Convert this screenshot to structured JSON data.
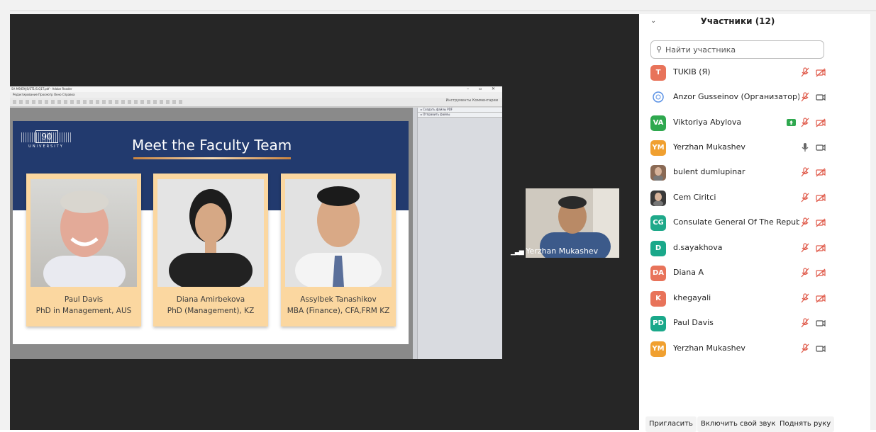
{
  "acrobat": {
    "titlebar": "SA M9/E9/JS/ST1/S.Q1T.pdf - Adobe Reader",
    "menubar": "Редактирование   Просмотр   Окно   Справка",
    "toolbar_right": "Инструменты     Комментарии",
    "side_tab_1": "▸ Создать файлы PDF",
    "side_tab_2": "▸ Отправить файлы",
    "window_buttons": "–  ▫  ✕"
  },
  "slide": {
    "logo_number": "90",
    "logo_text": "UNIVERSITY",
    "title": "Meet the Faculty Team",
    "cards": [
      {
        "name": "Paul Davis",
        "degree": "PhD in Management,  AUS"
      },
      {
        "name": "Diana Amirbekova",
        "degree": "PhD (Management), KZ"
      },
      {
        "name": "Assylbek Tanashikov",
        "degree": "MBA (Finance), CFA,FRM KZ"
      }
    ]
  },
  "video_tile": {
    "label": "Yerzhan Mukashev",
    "signal_icon": "signal-bars-icon"
  },
  "participants": {
    "title": "Участники (12)",
    "search_placeholder": "Найти участника",
    "list": [
      {
        "initials": "T",
        "color": "#e8735a",
        "name": "TUKIB (Я)",
        "mic": "muted",
        "video": "off"
      },
      {
        "initials": "",
        "color": "#ffffff",
        "name": "Anzor Gusseinov (Организатор)",
        "mic": "muted",
        "video": "on",
        "avatar": "un-logo-avatar"
      },
      {
        "initials": "VA",
        "color": "#2fa84f",
        "name": "Viktoriya Abylova",
        "mic": "muted",
        "video": "off",
        "share": true
      },
      {
        "initials": "YM",
        "color": "#f0a030",
        "name": "Yerzhan Mukashev",
        "mic": "active",
        "video": "on"
      },
      {
        "initials": "",
        "color": "#8a6a55",
        "name": "bulent dumlupinar",
        "mic": "muted",
        "video": "off",
        "avatar": "photo-avatar"
      },
      {
        "initials": "",
        "color": "#3a3a3a",
        "name": "Cem Ciritci",
        "mic": "muted",
        "video": "off",
        "avatar": "photo-avatar"
      },
      {
        "initials": "CG",
        "color": "#1fa98a",
        "name": "Consulate General Of The Republ...",
        "mic": "muted",
        "video": "off"
      },
      {
        "initials": "D",
        "color": "#1aa88a",
        "name": "d.sayakhova",
        "mic": "muted",
        "video": "off"
      },
      {
        "initials": "DA",
        "color": "#e8735a",
        "name": "Diana A",
        "mic": "muted",
        "video": "off"
      },
      {
        "initials": "K",
        "color": "#e8735a",
        "name": "khegayali",
        "mic": "muted",
        "video": "off"
      },
      {
        "initials": "PD",
        "color": "#1aa88a",
        "name": "Paul Davis",
        "mic": "muted",
        "video": "on"
      },
      {
        "initials": "YM",
        "color": "#f0a030",
        "name": "Yerzhan Mukashev",
        "mic": "muted",
        "video": "on"
      }
    ]
  },
  "buttons": {
    "invite": "Пригласить",
    "unmute": "Включить свой звук",
    "raise_hand": "Поднять руку"
  },
  "colors": {
    "meeting_bg": "#262626",
    "slide_band": "#223a6e",
    "card_bg": "#fbd7a0",
    "muted_icon": "#e05b4b"
  }
}
